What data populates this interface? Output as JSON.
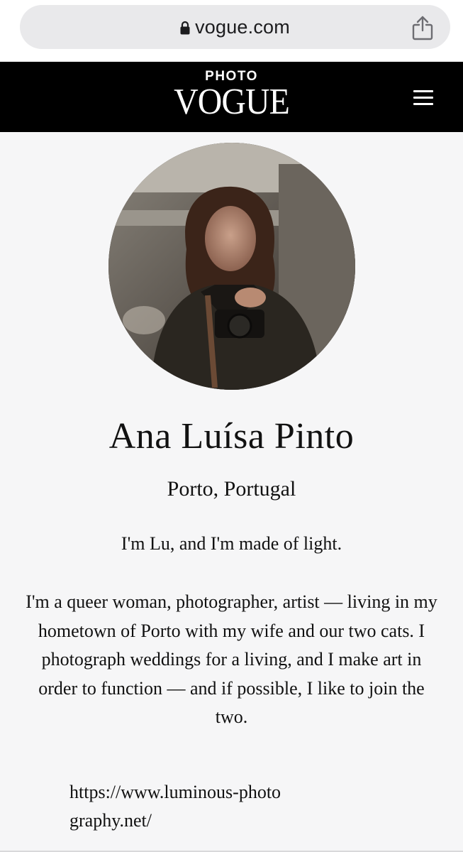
{
  "browser": {
    "url": "vogue.com",
    "lock_icon": "lock-icon",
    "share_icon": "share-icon"
  },
  "header": {
    "logo_top": "PHOTO",
    "logo_main": "VOGUE",
    "menu_icon": "hamburger-menu-icon",
    "background": "#000000"
  },
  "profile": {
    "name": "Ana Luísa Pinto",
    "location": "Porto, Portugal",
    "bio_intro": "I'm Lu, and I'm made of light.",
    "bio_body": "I'm a queer woman, photographer, artist — living in my hometown of Porto with my wife and our two cats. I photograph weddings for a living, and I make art in order to function — and if possible, I like to join the two.",
    "website": "https://www.luminous-photography.net/"
  },
  "colors": {
    "page_background": "#f6f6f7",
    "url_bar": "#e9e9eb",
    "text": "#111111"
  }
}
